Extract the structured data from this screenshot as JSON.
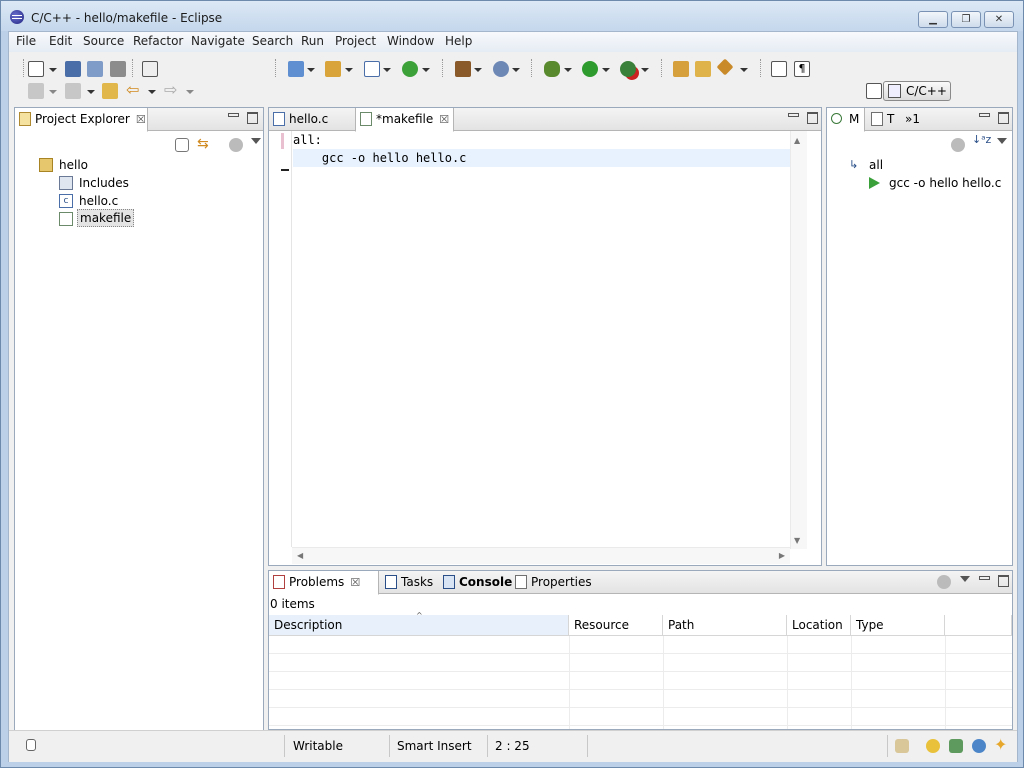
{
  "window": {
    "title": "C/C++ - hello/makefile - Eclipse"
  },
  "menubar": [
    "File",
    "Edit",
    "Source",
    "Refactor",
    "Navigate",
    "Search",
    "Run",
    "Project",
    "Window",
    "Help"
  ],
  "toolbar": {
    "perspective_label": "C/C++"
  },
  "project_explorer": {
    "tab_label": "Project Explorer",
    "tree": [
      {
        "label": "hello",
        "icon": "project-folder-icon"
      },
      {
        "label": "Includes",
        "icon": "includes-icon"
      },
      {
        "label": "hello.c",
        "icon": "c-file-icon"
      },
      {
        "label": "makefile",
        "icon": "makefile-icon"
      }
    ]
  },
  "editor": {
    "tabs": [
      {
        "label": "hello.c"
      },
      {
        "label": "*makefile"
      }
    ],
    "lines": [
      "all:",
      "\tgcc -o hello hello.c"
    ]
  },
  "outline": {
    "tabs": [
      {
        "label": "M"
      },
      {
        "label": "T"
      },
      {
        "label": "»1"
      }
    ],
    "items": [
      {
        "label": "all"
      },
      {
        "label": "gcc -o hello hello.c"
      }
    ]
  },
  "bottom": {
    "tabs": [
      {
        "label": "Problems"
      },
      {
        "label": "Tasks"
      },
      {
        "label": "Console"
      },
      {
        "label": "Properties"
      }
    ],
    "count": "0 items",
    "columns": [
      "Description",
      "Resource",
      "Path",
      "Location",
      "Type"
    ]
  },
  "statusbar": {
    "mode": "Writable",
    "insert": "Smart Insert",
    "position": "2 : 25"
  }
}
